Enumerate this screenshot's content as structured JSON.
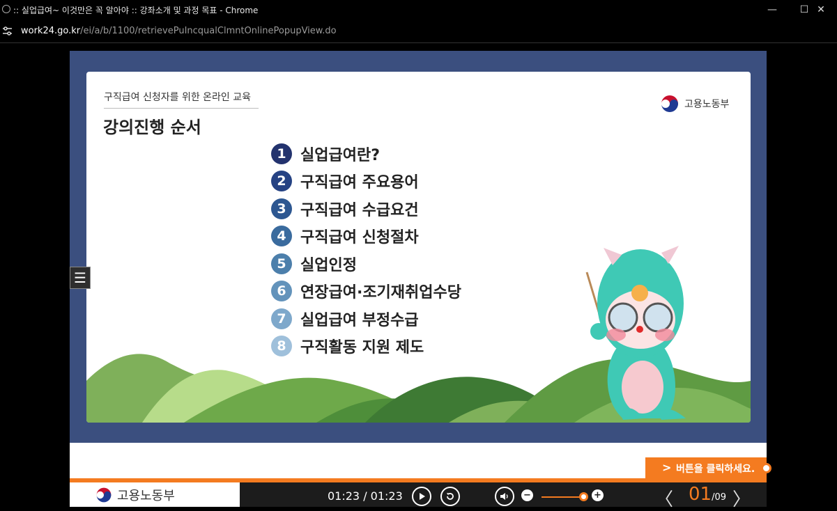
{
  "window": {
    "title": ":: 실업급여~ 이것만은 꼭 알아야 :: 강좌소개 및 과정 목표 - Chrome",
    "minimize_glyph": "—",
    "maximize_glyph": "☐",
    "close_glyph": "✕"
  },
  "address": {
    "host": "work24.go.kr",
    "path": "/ei/a/b/1100/retrievePuIncqualClmntOnlinePopupView.do",
    "site_icon": "tune-icon"
  },
  "slide": {
    "subtitle": "구직급여 신청자를 위한 온라인 교육",
    "heading": "강의진행 순서",
    "logo_text": "고용노동부",
    "agenda": [
      {
        "num": "1",
        "label": "실업급여란?",
        "color": "#23336e"
      },
      {
        "num": "2",
        "label": "구직급여 주요용어",
        "color": "#254283"
      },
      {
        "num": "3",
        "label": "구직급여 수급요건",
        "color": "#2d5791"
      },
      {
        "num": "4",
        "label": "구직급여 신청절차",
        "color": "#3a6b9e"
      },
      {
        "num": "5",
        "label": "실업인정",
        "color": "#4c7fab"
      },
      {
        "num": "6",
        "label": "연장급여·조기재취업수당",
        "color": "#6393bb"
      },
      {
        "num": "7",
        "label": "실업급여 부정수급",
        "color": "#7ea8cb"
      },
      {
        "num": "8",
        "label": "구직활동 지원 제도",
        "color": "#9fc0db"
      }
    ]
  },
  "menu_glyph": "☰",
  "hint": {
    "arrow": ">",
    "text": "버튼을 클릭하세요."
  },
  "player": {
    "logo_text": "고용노동부",
    "time": "01:23 / 01:23",
    "volume_level": 0.9,
    "page_current": "01",
    "page_total": "/09",
    "prev_glyph": "〈",
    "next_glyph": "〉",
    "minus_glyph": "−",
    "plus_glyph": "+"
  },
  "colors": {
    "accent": "#f47b20",
    "stage_border": "#3b4f7f"
  }
}
